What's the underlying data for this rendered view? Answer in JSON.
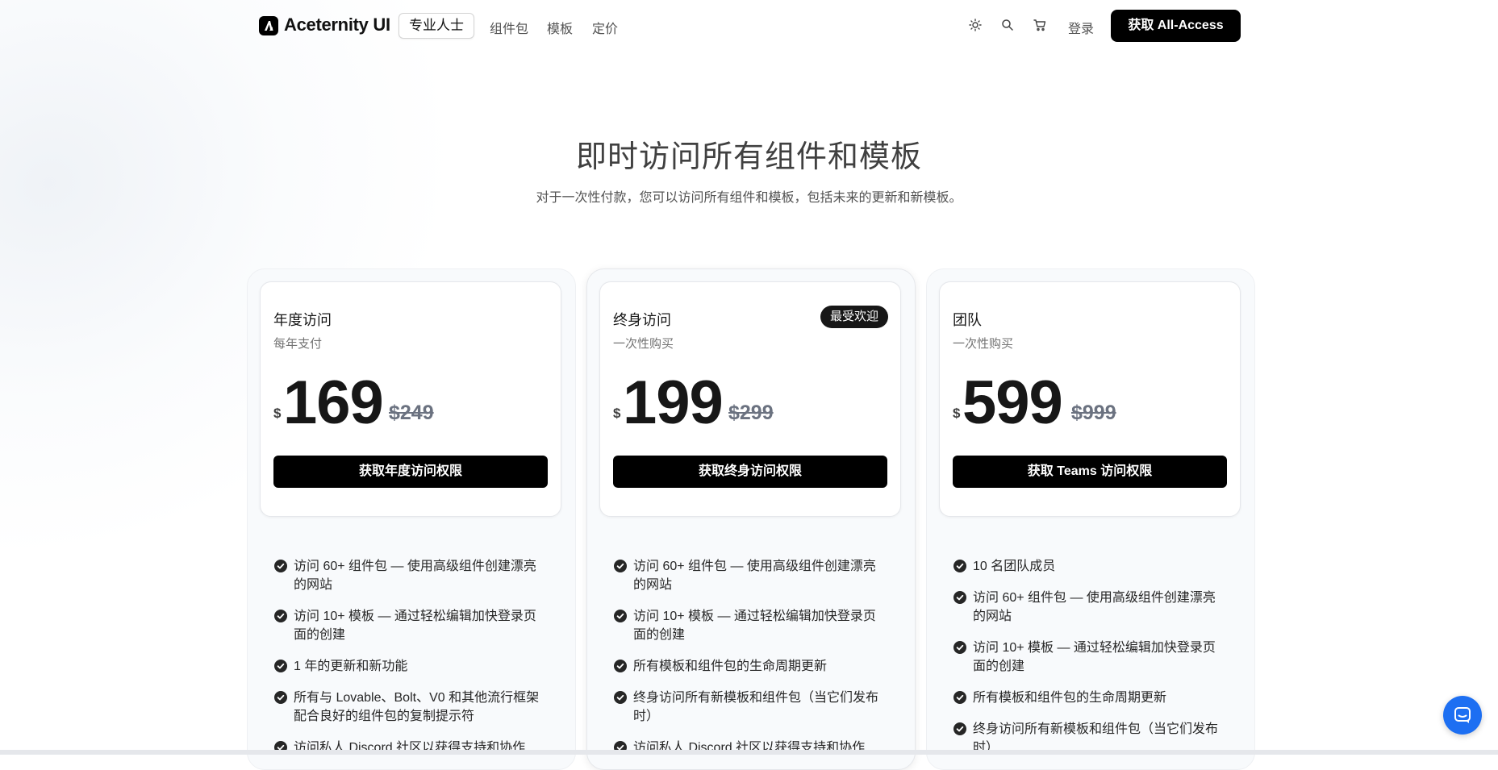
{
  "brand": {
    "name": "Aceternity UI",
    "badge": "专业人士"
  },
  "nav": {
    "links": [
      "组件包",
      "模板",
      "定价"
    ],
    "icons": [
      "sun-icon",
      "search-icon",
      "cart-icon"
    ],
    "login": "登录",
    "cta": "获取 All-Access"
  },
  "hero": {
    "title": "即时访问所有组件和模板",
    "subtitle": "对于一次性付款，您可以访问所有组件和模板，包括未来的更新和新模板。"
  },
  "plans": [
    {
      "name": "年度访问",
      "note": "每年支付",
      "currency": "$",
      "price": "169",
      "old_price": "$249",
      "button": "获取年度访问权限",
      "features": [
        "访问 60+ 组件包 — 使用高级组件创建漂亮的网站",
        "访问 10+ 模板 — 通过轻松编辑加快登录页面的创建",
        "1 年的更新和新功能",
        "所有与 Lovable、Bolt、V0 和其他流行框架配合良好的组件包的复制提示符",
        "访问私人 Discord 社区以获得支持和协作"
      ]
    },
    {
      "name": "终身访问",
      "note": "一次性购买",
      "badge": "最受欢迎",
      "currency": "$",
      "price": "199",
      "old_price": "$299",
      "button": "获取终身访问权限",
      "features": [
        "访问 60+ 组件包 — 使用高级组件创建漂亮的网站",
        "访问 10+ 模板 — 通过轻松编辑加快登录页面的创建",
        "所有模板和组件包的生命周期更新",
        "终身访问所有新模板和组件包（当它们发布时）",
        "访问私人 Discord 社区以获得支持和协作"
      ]
    },
    {
      "name": "团队",
      "note": "一次性购买",
      "currency": "$",
      "price": "599",
      "old_price": "$999",
      "button": "获取 Teams 访问权限",
      "features": [
        "10 名团队成员",
        "访问 60+ 组件包 — 使用高级组件创建漂亮的网站",
        "访问 10+ 模板 — 通过轻松编辑加快登录页面的创建",
        "所有模板和组件包的生命周期更新",
        "终身访问所有新模板和组件包（当它们发布时）"
      ]
    }
  ],
  "chat": {
    "icon": "chat-icon"
  },
  "colors": {
    "accent": "#000000",
    "chat": "#1d6ff2",
    "muted": "#737373"
  }
}
